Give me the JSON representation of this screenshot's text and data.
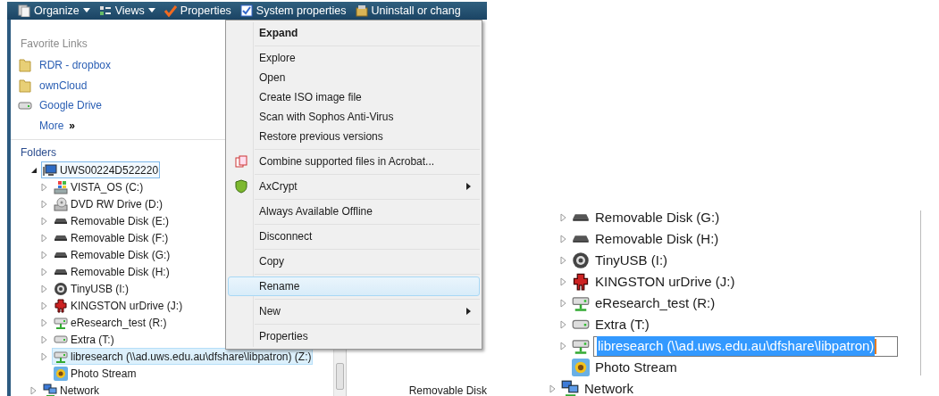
{
  "toolbar": {
    "buttons": [
      {
        "label": "Organize",
        "kind": "organize",
        "dropdown": true
      },
      {
        "label": "Views",
        "kind": "views",
        "dropdown": true
      },
      {
        "label": "Properties",
        "kind": "check",
        "dropdown": false
      },
      {
        "label": "System properties",
        "kind": "window",
        "dropdown": false
      },
      {
        "label": "Uninstall or chang",
        "kind": "box",
        "dropdown": false
      }
    ]
  },
  "navigation": {
    "favorites_title": "Favorite Links",
    "favorites": [
      {
        "label": "RDR - dropbox",
        "kind": "folder"
      },
      {
        "label": "ownCloud",
        "kind": "folder"
      },
      {
        "label": "Google Drive",
        "kind": "drive"
      }
    ],
    "more": "More",
    "more_glyph": "»",
    "folders_title": "Folders",
    "tree": [
      {
        "label": "UWS00224D522220",
        "kind": "computer",
        "expandable": true,
        "expanded": true,
        "focused": true,
        "selected": false,
        "children": [
          {
            "label": "VISTA_OS (C:)",
            "kind": "windows",
            "expandable": true,
            "expanded": false,
            "focused": false,
            "selected": false
          },
          {
            "label": "DVD RW Drive (D:)",
            "kind": "dvd",
            "expandable": true,
            "expanded": false,
            "focused": false,
            "selected": false
          },
          {
            "label": "Removable Disk (E:)",
            "kind": "removable",
            "expandable": true,
            "expanded": false,
            "focused": false,
            "selected": false
          },
          {
            "label": "Removable Disk (F:)",
            "kind": "removable",
            "expandable": true,
            "expanded": false,
            "focused": false,
            "selected": false
          },
          {
            "label": "Removable Disk (G:)",
            "kind": "removable",
            "expandable": true,
            "expanded": false,
            "focused": false,
            "selected": false
          },
          {
            "label": "Removable Disk (H:)",
            "kind": "removable",
            "expandable": true,
            "expanded": false,
            "focused": false,
            "selected": false
          },
          {
            "label": "TinyUSB (I:)",
            "kind": "gear",
            "expandable": true,
            "expanded": false,
            "focused": false,
            "selected": false
          },
          {
            "label": "KINGSTON urDrive (J:)",
            "kind": "kingston",
            "expandable": true,
            "expanded": false,
            "focused": false,
            "selected": false
          },
          {
            "label": "eResearch_test (R:)",
            "kind": "netdrive",
            "expandable": true,
            "expanded": false,
            "focused": false,
            "selected": false
          },
          {
            "label": "Extra (T:)",
            "kind": "drive",
            "expandable": true,
            "expanded": false,
            "focused": false,
            "selected": false
          },
          {
            "label": "libresearch (\\\\ad.uws.edu.au\\dfshare\\libpatron) (Z:)",
            "kind": "netdrive",
            "expandable": true,
            "expanded": false,
            "focused": false,
            "selected": true
          },
          {
            "label": "Photo Stream",
            "kind": "photos",
            "expandable": false,
            "expanded": false,
            "focused": false,
            "selected": false
          }
        ]
      },
      {
        "label": "Network",
        "kind": "network",
        "expandable": true,
        "expanded": false,
        "focused": false,
        "selected": false
      }
    ]
  },
  "content": {
    "fragment": "Removable Disk"
  },
  "context_menu": {
    "items": [
      {
        "kind": "item",
        "label": "Expand",
        "bold": true,
        "selected": false,
        "submenu": false
      },
      {
        "kind": "separator"
      },
      {
        "kind": "item",
        "label": "Explore",
        "bold": false,
        "selected": false,
        "submenu": false
      },
      {
        "kind": "item",
        "label": "Open",
        "bold": false,
        "selected": false,
        "submenu": false
      },
      {
        "kind": "item",
        "label": "Create ISO image file",
        "bold": false,
        "selected": false,
        "submenu": false
      },
      {
        "kind": "item",
        "label": "Scan with Sophos Anti-Virus",
        "bold": false,
        "selected": false,
        "submenu": false
      },
      {
        "kind": "item",
        "label": "Restore previous versions",
        "bold": false,
        "selected": false,
        "submenu": false
      },
      {
        "kind": "separator"
      },
      {
        "kind": "pdf",
        "label": "Combine supported files in Acrobat...",
        "bold": false,
        "selected": false,
        "submenu": false
      },
      {
        "kind": "separator"
      },
      {
        "kind": "shield",
        "label": "AxCrypt",
        "bold": false,
        "selected": false,
        "submenu": true
      },
      {
        "kind": "separator"
      },
      {
        "kind": "item",
        "label": "Always Available Offline",
        "bold": false,
        "selected": false,
        "submenu": false
      },
      {
        "kind": "separator"
      },
      {
        "kind": "item",
        "label": "Disconnect",
        "bold": false,
        "selected": false,
        "submenu": false
      },
      {
        "kind": "separator"
      },
      {
        "kind": "item",
        "label": "Copy",
        "bold": false,
        "selected": false,
        "submenu": false
      },
      {
        "kind": "separator"
      },
      {
        "kind": "item",
        "label": "Rename",
        "bold": false,
        "selected": true,
        "submenu": false
      },
      {
        "kind": "separator"
      },
      {
        "kind": "item",
        "label": "New",
        "bold": false,
        "selected": false,
        "submenu": true
      },
      {
        "kind": "separator"
      },
      {
        "kind": "item",
        "label": "Properties",
        "bold": false,
        "selected": false,
        "submenu": false
      }
    ]
  },
  "rename_view": {
    "rows": [
      {
        "label": "Removable Disk (G:)",
        "kind": "removable",
        "expandable": true,
        "indent": true,
        "editing": false
      },
      {
        "label": "Removable Disk (H:)",
        "kind": "removable",
        "expandable": true,
        "indent": true,
        "editing": false
      },
      {
        "label": "TinyUSB (I:)",
        "kind": "gear",
        "expandable": true,
        "indent": true,
        "editing": false
      },
      {
        "label": "KINGSTON urDrive (J:)",
        "kind": "kingston",
        "expandable": true,
        "indent": true,
        "editing": false
      },
      {
        "label": "eResearch_test (R:)",
        "kind": "netdrive",
        "expandable": true,
        "indent": true,
        "editing": false
      },
      {
        "label": "Extra (T:)",
        "kind": "drive",
        "expandable": true,
        "indent": true,
        "editing": false
      },
      {
        "label": "libresearch (\\\\ad.uws.edu.au\\dfshare\\libpatron)",
        "kind": "netdrive",
        "expandable": true,
        "indent": true,
        "editing": true
      },
      {
        "label": "Photo Stream",
        "kind": "photos",
        "expandable": false,
        "indent": true,
        "editing": false
      },
      {
        "label": "Network",
        "kind": "network",
        "expandable": true,
        "indent": false,
        "editing": false
      }
    ]
  }
}
